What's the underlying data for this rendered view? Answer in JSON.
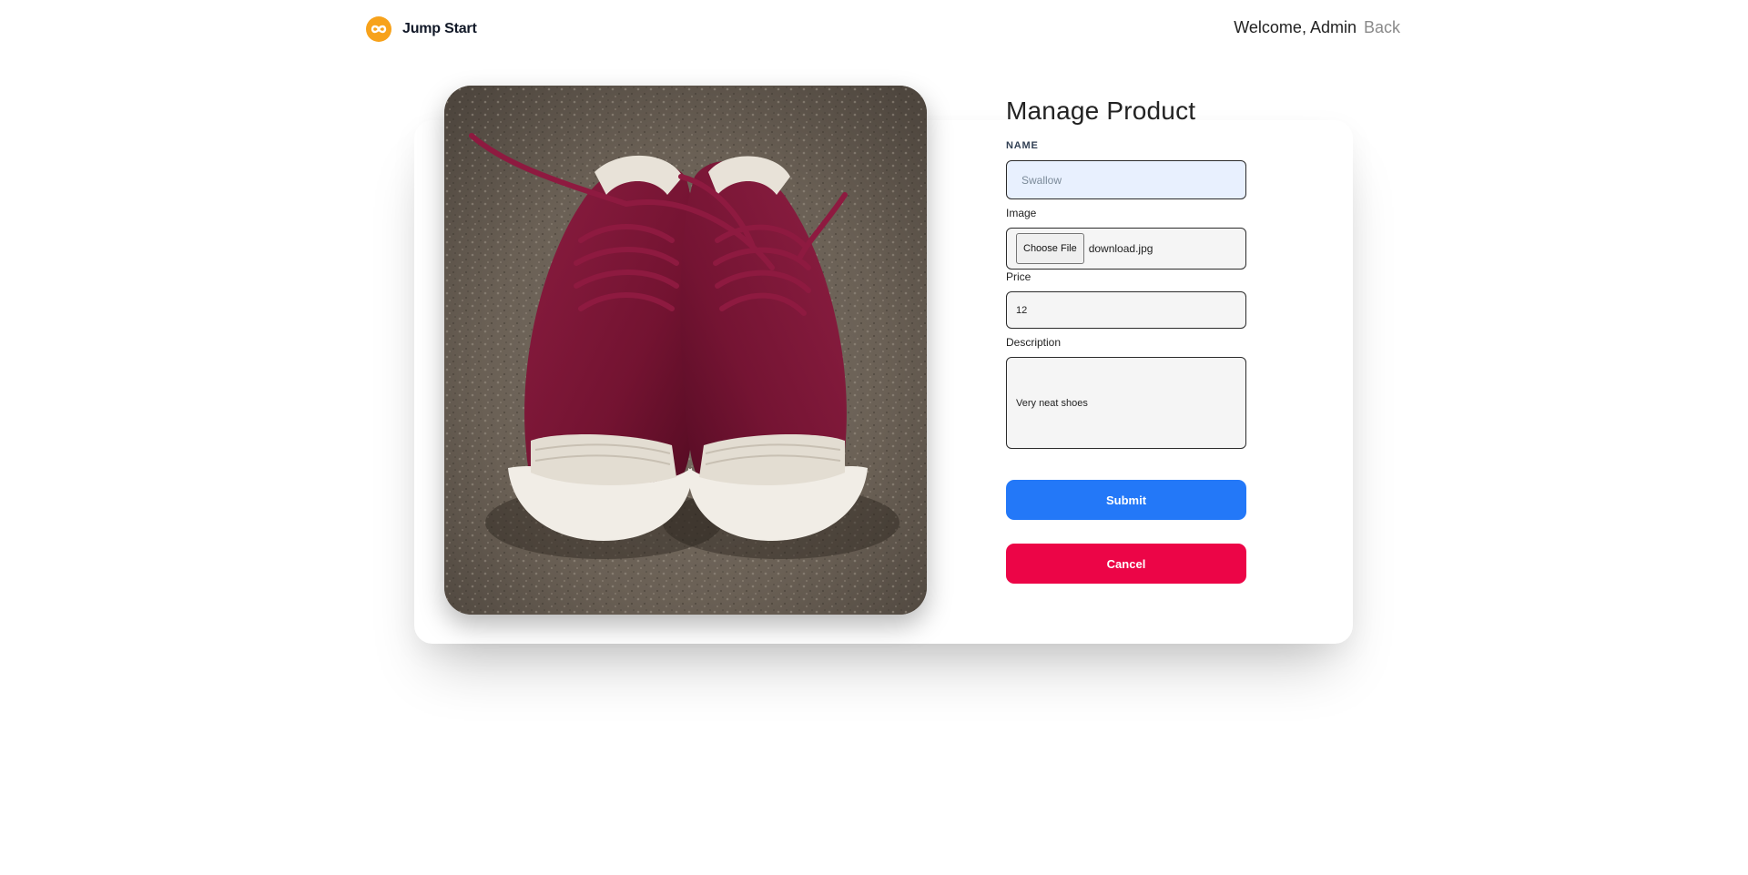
{
  "header": {
    "brand_name": "Jump Start",
    "logo_icon": "infinity-logo-icon",
    "welcome_text": "Welcome, Admin",
    "back_label": "Back"
  },
  "product_image": {
    "subject": "pair of burgundy canvas sneakers with white toe caps on gravel"
  },
  "form": {
    "title": "Manage Product",
    "name": {
      "label": "NAME",
      "placeholder": "Swallow",
      "value": ""
    },
    "image": {
      "label": "Image",
      "button_label": "Choose File",
      "file_name": "download.jpg"
    },
    "price": {
      "label": "Price",
      "value": "12"
    },
    "description": {
      "label": "Description",
      "value": "Very neat shoes"
    },
    "submit_label": "Submit",
    "cancel_label": "Cancel"
  },
  "colors": {
    "brand_orange": "#f7a21b",
    "submit_blue": "#2378f8",
    "cancel_red": "#ec0547",
    "shoe_burgundy": "#7a1535"
  }
}
